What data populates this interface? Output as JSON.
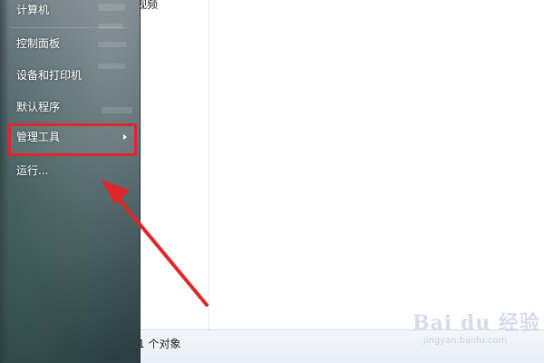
{
  "explorer": {
    "nav_fragment": "视频",
    "status_text": "1 个对象"
  },
  "start_menu": {
    "items": [
      {
        "label": "计算机"
      },
      {
        "label": "控制面板"
      },
      {
        "label": "设备和打印机"
      },
      {
        "label": "默认程序"
      },
      {
        "label": "管理工具",
        "has_submenu": true,
        "highlighted": true
      },
      {
        "label": "运行..."
      }
    ]
  },
  "annotation": {
    "arrow_color": "#e0262a",
    "highlight_color": "#e0262a"
  },
  "watermark": {
    "brand": "Bai du 经验",
    "url": "jingyan.baidu.com"
  }
}
